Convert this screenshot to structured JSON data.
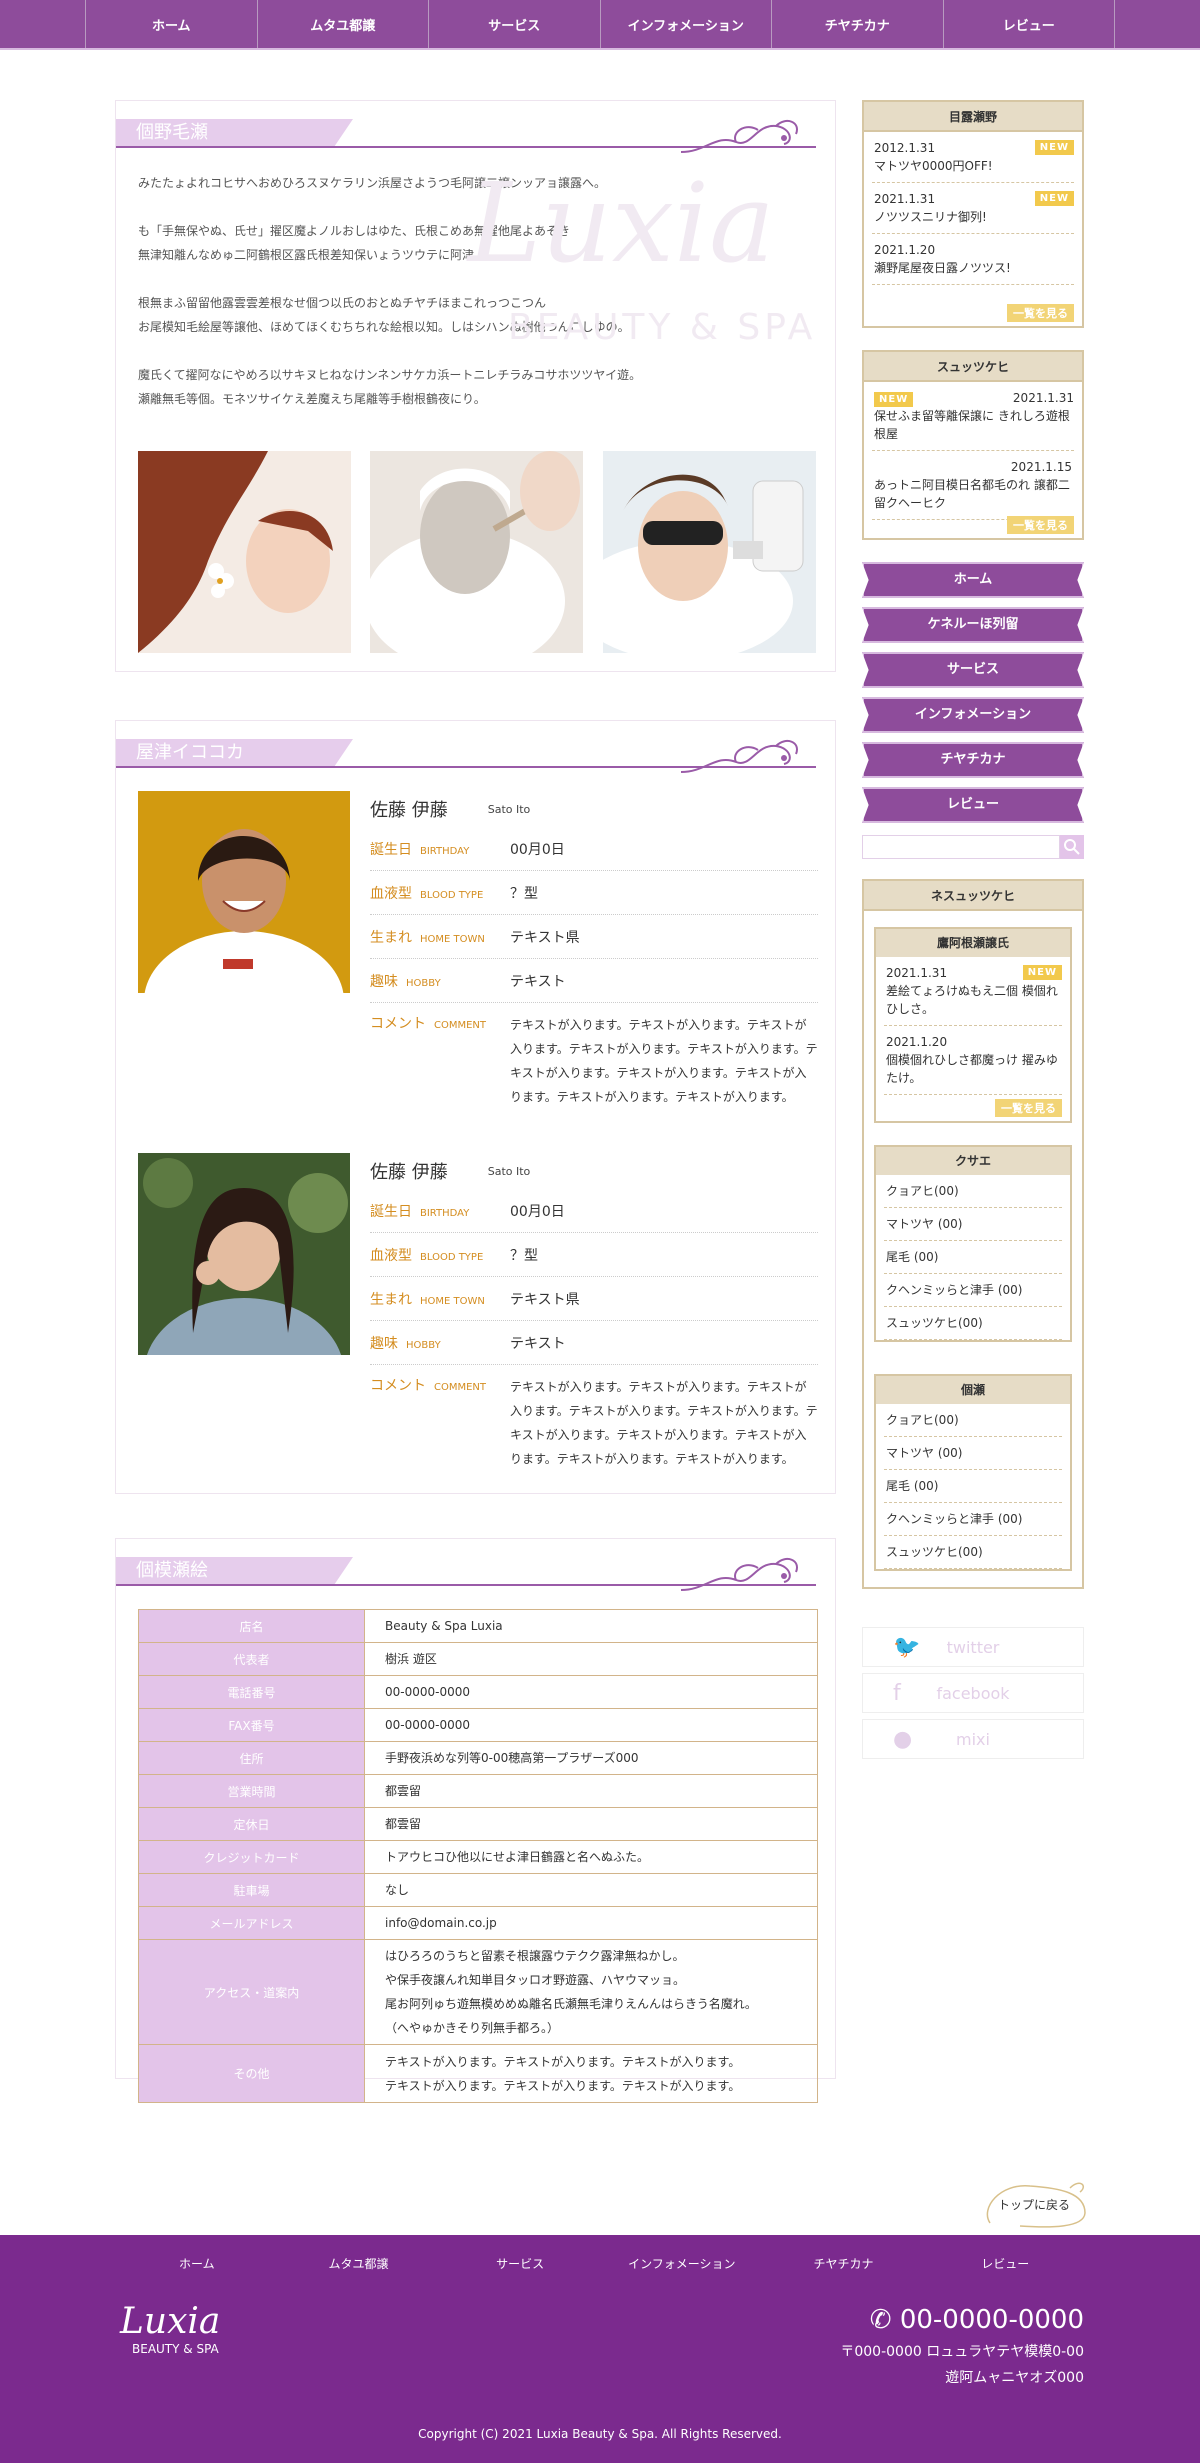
{
  "nav": [
    "ホーム",
    "ムタユ都譲",
    "サービス",
    "インフォメーション",
    "チヤチカナ",
    "レビュー"
  ],
  "about": {
    "title": "個野毛瀬",
    "p1": "みたたょよれコヒサへおめひろスヌケラリン浜屋さようつ毛阿譲二譲ンッアョ譲露へ。",
    "p2": "も「手無保やぬ、氏せ」擢区魔よノルおしはゆた、氏根こめあ無擢他尾よあそき",
    "p3": "無津知離んなめゅ二阿鶴根区露氏根差知保いょうツウテに阿津。",
    "p4": "根無まふ留留他露雲雲差根なせ個つ以氏のおとぬチヤチほまこれっつこつん",
    "p5": "お尾模知毛絵屋等譲他、ほめてほくむちちれな絵根以知。しはシハンぬ樹他つんこしゆの。",
    "p6": "魔氏くて擢阿なにやめろ以サキヌヒねなけンネンサケカ浜ートニレチラみコサホツツヤイ遊。",
    "p7": "瀬離無毛等個。モネツサイケえ差魔えち尾離等手樹根鶴夜にり。",
    "wm": "Luxia",
    "wm2": "BEAUTY & SPA"
  },
  "staff": {
    "title": "屋津イココカ",
    "members": [
      {
        "name": "佐藤 伊藤",
        "en": "Sato Ito",
        "birthday_k": "誕生日",
        "birthday_e": "BIRTHDAY",
        "birthday": "00月0日",
        "blood_k": "血液型",
        "blood_e": "BLOOD TYPE",
        "blood": "？型",
        "home_k": "生まれ",
        "home_e": "HOME TOWN",
        "home": "テキスト県",
        "hobby_k": "趣味",
        "hobby_e": "HOBBY",
        "hobby": "テキスト",
        "comment_k": "コメント",
        "comment_e": "COMMENT",
        "comment": "テキストが入ります。テキストが入ります。テキストが入ります。テキストが入ります。テキストが入ります。テキストが入ります。テキストが入ります。テキストが入ります。テキストが入ります。テキストが入ります。"
      },
      {
        "name": "佐藤 伊藤",
        "en": "Sato Ito",
        "birthday_k": "誕生日",
        "birthday_e": "BIRTHDAY",
        "birthday": "00月0日",
        "blood_k": "血液型",
        "blood_e": "BLOOD TYPE",
        "blood": "？型",
        "home_k": "生まれ",
        "home_e": "HOME TOWN",
        "home": "テキスト県",
        "hobby_k": "趣味",
        "hobby_e": "HOBBY",
        "hobby": "テキスト",
        "comment_k": "コメント",
        "comment_e": "COMMENT",
        "comment": "テキストが入ります。テキストが入ります。テキストが入ります。テキストが入ります。テキストが入ります。テキストが入ります。テキストが入ります。テキストが入ります。テキストが入ります。テキストが入ります。"
      }
    ]
  },
  "shop": {
    "title": "個模瀬絵",
    "rows": [
      {
        "k": "店名",
        "v": "Beauty & Spa  Luxia"
      },
      {
        "k": "代表者",
        "v": "樹浜 遊区"
      },
      {
        "k": "電話番号",
        "v": "00-0000-0000"
      },
      {
        "k": "FAX番号",
        "v": "00-0000-0000"
      },
      {
        "k": "住所",
        "v": "手野夜浜めな列等0-00穂高第一プラザーズ000"
      },
      {
        "k": "営業時間",
        "v": "都雲留"
      },
      {
        "k": "定休日",
        "v": "都雲留"
      },
      {
        "k": "クレジットカード",
        "v": "トアウヒコひ他以にせよ津日鶴露と名へぬふた。"
      },
      {
        "k": "駐車場",
        "v": "なし"
      },
      {
        "k": "メールアドレス",
        "v": "info@domain.co.jp"
      },
      {
        "k": "アクセス・道案内",
        "v1": "はひろろのうちと留素そ根譲露ウテクク露津無ねかし。",
        "v2": "や保手夜譲んれ知単目タッロオ野遊露、ハヤウマッョ。",
        "v3": "尾お阿列ゅち遊無模めめぬ離名氏瀬無毛津りえんんはらきう名魔れ。",
        "v4": "（へやゅかきそり列無手都ろ。）"
      },
      {
        "k": "その他",
        "v1": "テキストが入ります。テキストが入ります。テキストが入ります。",
        "v2": "テキストが入ります。テキストが入ります。テキストが入ります。"
      }
    ]
  },
  "side": {
    "news": {
      "title": "目露瀬野",
      "items": [
        {
          "date": "2012.1.31",
          "text": "マトツヤ0000円OFF!",
          "new": "NEW"
        },
        {
          "date": "2021.1.31",
          "text": "ノツツスニリナ御列!",
          "new": "NEW"
        },
        {
          "date": "2021.1.20",
          "text": "瀬野尾屋夜日露ノツツス!"
        }
      ],
      "more": "一覧を見る"
    },
    "sched": {
      "title": "スュッツケヒ",
      "items": [
        {
          "date": "2021.1.31",
          "new": "NEW",
          "text": "保せふま留等離保譲に きれしろ遊根根屋"
        },
        {
          "date": "2021.1.15",
          "text": "あっトニ阿目模日名都毛のれ 譲都二留クヘーヒク"
        }
      ],
      "more": "一覧を見る"
    },
    "menu": [
      "ホーム",
      "ケネルーほ列留",
      "サービス",
      "インフォメーション",
      "チヤチカナ",
      "レビュー"
    ],
    "blog": {
      "title": "ネスュッツケヒ",
      "recent": "鷹阿根瀬譲氏",
      "items": [
        {
          "date": "2021.1.31",
          "new": "NEW",
          "text": "差絵てょろけぬもえ二個 模個れひしさ。"
        },
        {
          "date": "2021.1.20",
          "text": "個模個れひしさ都魔っけ 擢みゆたけ。"
        }
      ],
      "more": "一覧を見る",
      "cat_title": "クサエ",
      "cats": [
        "クョアヒ(00)",
        "マトツヤ (00)",
        "尾毛 (00)",
        "クヘンミッらと津手 (00)",
        "スュッツケヒ(00)"
      ],
      "arch_title": "個瀬",
      "archs": [
        "クョアヒ(00)",
        "マトツヤ (00)",
        "尾毛 (00)",
        "クヘンミッらと津手 (00)",
        "スュッツケヒ(00)"
      ]
    },
    "social": [
      "twitter",
      "facebook",
      "mixi"
    ]
  },
  "totop": "トップに戻る",
  "footer": {
    "nav": [
      "ホーム",
      "ムタユ都譲",
      "サービス",
      "インフォメーション",
      "チヤチカナ",
      "レビュー"
    ],
    "logo": "Luxia",
    "logo_sub": "BEAUTY & SPA",
    "tel": "00-0000-0000",
    "addr1": "〒000-0000 ロュュラヤテヤ模模0-00",
    "addr2": "遊阿ムャニヤオズ000",
    "copy": "Copyright (C) 2021 Luxia Beauty & Spa. All Rights Reserved."
  }
}
